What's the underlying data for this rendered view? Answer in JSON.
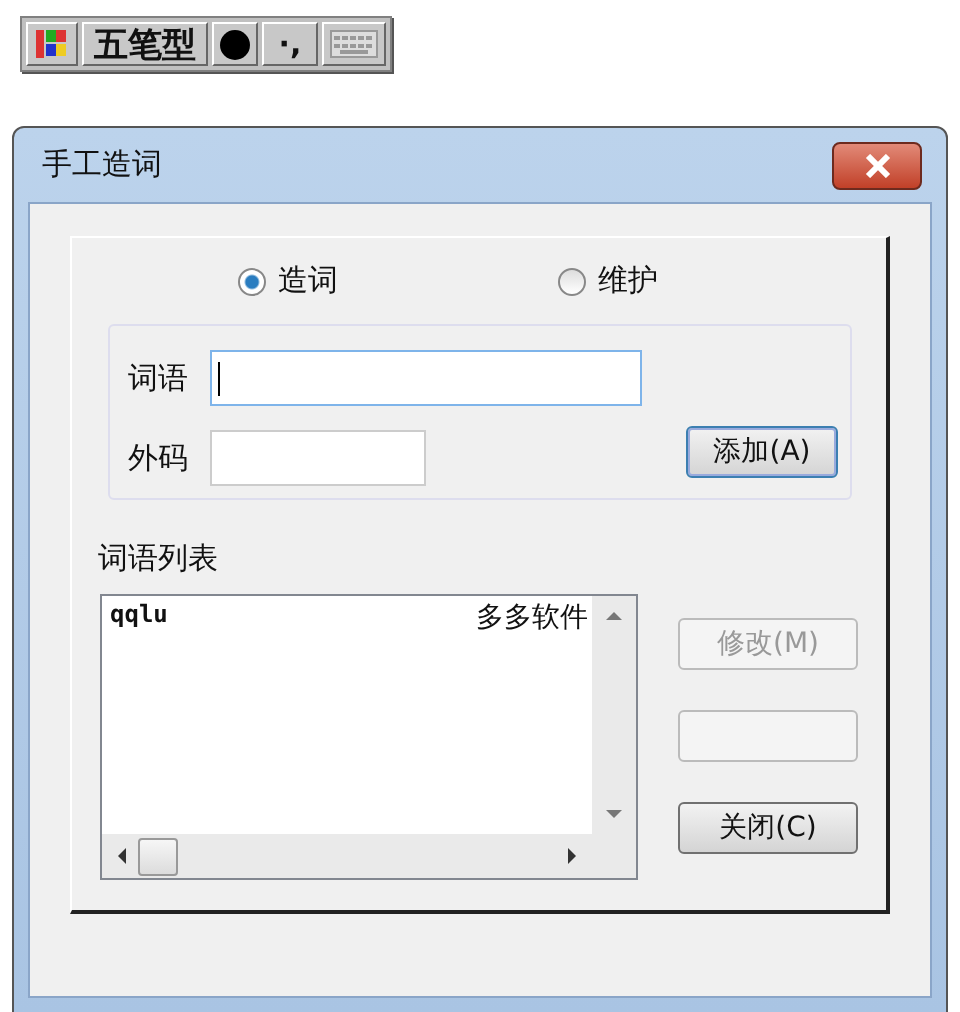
{
  "ime_toolbar": {
    "mode": "五笔型",
    "punctuation": "·,"
  },
  "window": {
    "title": "手工造词"
  },
  "options": [
    {
      "label": "造词",
      "selected": true
    },
    {
      "label": "维护",
      "selected": false
    }
  ],
  "fields": [
    {
      "label": "词语",
      "focused": true
    },
    {
      "label": "外码",
      "focused": false
    }
  ],
  "add_button": {
    "label": "添加(A)",
    "default": true
  },
  "word_list": {
    "label": "词语列表",
    "rows": [
      {
        "code": "qqlu",
        "word": "多多软件"
      }
    ]
  },
  "side_buttons": [
    {
      "label": "修改(M)",
      "disabled": true
    },
    {
      "disabled": true
    },
    {
      "label": "关闭(C)",
      "disabled": false
    }
  ]
}
